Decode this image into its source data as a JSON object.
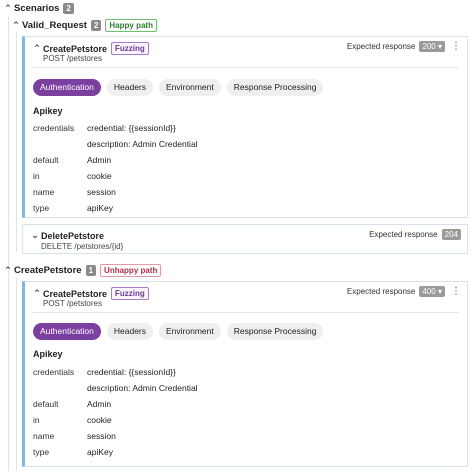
{
  "scenarios": {
    "label": "Scenarios",
    "count": "2"
  },
  "groups": [
    {
      "name": "Valid_Request",
      "count": "2",
      "tag": "Happy path",
      "ops": [
        {
          "title": "CreatePetstore",
          "tag": "Fuzzing",
          "method_path": "POST /petstores",
          "expected_label": "Expected response",
          "expected_code": "200",
          "tabs": [
            "Authentication",
            "Headers",
            "Environment",
            "Response Processing"
          ],
          "section": "Apikey",
          "fields": {
            "credentials": "credentials",
            "credential_value": "credential: {{sessionId}}",
            "description_value": "description: Admin Credential",
            "default": "default",
            "default_value": "Admin",
            "in": "in",
            "in_value": "cookie",
            "name": "name",
            "name_value": "session",
            "type": "type",
            "type_value": "apiKey"
          }
        },
        {
          "title": "DeletePetstore",
          "method_path": "DELETE /petstores/{id}",
          "expected_label": "Expected response",
          "expected_code": "204"
        }
      ]
    },
    {
      "name": "CreatePetstore",
      "count": "1",
      "tag": "Unhappy path",
      "ops": [
        {
          "title": "CreatePetstore",
          "tag": "Fuzzing",
          "method_path": "POST /petstores",
          "expected_label": "Expected response",
          "expected_code": "400",
          "tabs": [
            "Authentication",
            "Headers",
            "Environment",
            "Response Processing"
          ],
          "section": "Apikey",
          "fields": {
            "credentials": "credentials",
            "credential_value": "credential: {{sessionId}}",
            "description_value": "description: Admin Credential",
            "default": "default",
            "default_value": "Admin",
            "in": "in",
            "in_value": "cookie",
            "name": "name",
            "name_value": "session",
            "type": "type",
            "type_value": "apiKey"
          }
        }
      ]
    }
  ],
  "icons": {
    "expanded": "chevron-down-icon",
    "collapsed": "chevron-right-icon",
    "menu": "kebab-menu-icon",
    "dropdown": "caret-down-icon"
  }
}
